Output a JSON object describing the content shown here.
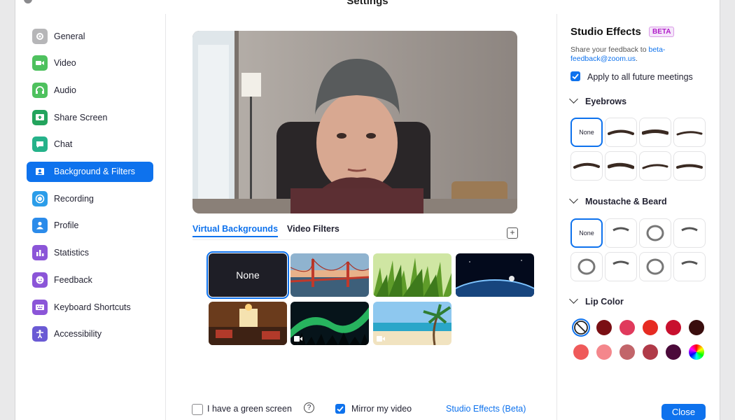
{
  "window": {
    "title": "Settings"
  },
  "sidebar": {
    "items": [
      {
        "label": "General",
        "icon": "gear-icon",
        "color": "#b6b6b8"
      },
      {
        "label": "Video",
        "icon": "video-camera-icon",
        "color": "#4ec15e"
      },
      {
        "label": "Audio",
        "icon": "headphones-icon",
        "color": "#4ec15e"
      },
      {
        "label": "Share Screen",
        "icon": "share-screen-icon",
        "color": "#23a45d"
      },
      {
        "label": "Chat",
        "icon": "chat-bubble-icon",
        "color": "#25b28a"
      },
      {
        "label": "Background & Filters",
        "icon": "person-background-icon",
        "color": "#0e72ed"
      },
      {
        "label": "Recording",
        "icon": "record-icon",
        "color": "#2b9de9"
      },
      {
        "label": "Profile",
        "icon": "user-icon",
        "color": "#2b8bea"
      },
      {
        "label": "Statistics",
        "icon": "bar-chart-icon",
        "color": "#8b55d8"
      },
      {
        "label": "Feedback",
        "icon": "smiley-icon",
        "color": "#8b55d8"
      },
      {
        "label": "Keyboard Shortcuts",
        "icon": "keyboard-icon",
        "color": "#8b55d8"
      },
      {
        "label": "Accessibility",
        "icon": "accessibility-icon",
        "color": "#6a5ad4"
      }
    ],
    "active_index": 5
  },
  "main": {
    "tabs": [
      {
        "label": "Virtual Backgrounds",
        "active": true
      },
      {
        "label": "Video Filters",
        "active": false
      }
    ],
    "add_button_label": "+",
    "backgrounds": [
      {
        "name": "None",
        "label": "None",
        "selected": true,
        "video": false
      },
      {
        "name": "Golden Gate Bridge",
        "selected": false,
        "video": false
      },
      {
        "name": "Grass",
        "selected": false,
        "video": false
      },
      {
        "name": "Earth from space",
        "selected": false,
        "video": false
      },
      {
        "name": "Lobby",
        "selected": false,
        "video": false
      },
      {
        "name": "Aurora",
        "selected": false,
        "video": true
      },
      {
        "name": "Beach",
        "selected": false,
        "video": true
      }
    ],
    "green_screen_label": "I have a green screen",
    "green_screen_checked": false,
    "mirror_label": "Mirror my video",
    "mirror_checked": true,
    "studio_effects_link": "Studio Effects (Beta)"
  },
  "studio": {
    "title": "Studio Effects",
    "badge": "BETA",
    "feedback_prefix": "Share your feedback to ",
    "feedback_email": "beta-feedback@zoom.us",
    "feedback_suffix": ".",
    "apply_label": "Apply to all future meetings",
    "apply_checked": true,
    "eyebrows_title": "Eyebrows",
    "eyebrows_none": "None",
    "beard_title": "Moustache & Beard",
    "beard_none": "None",
    "lip_title": "Lip Color",
    "lip_colors": [
      "none",
      "#7a0f14",
      "#e03a5c",
      "#e62b22",
      "#c8102e",
      "#3a0d0d",
      "#ef5a5a",
      "#f4878c",
      "#c2656a",
      "#b03a48",
      "#4b0a3a",
      "rainbow"
    ],
    "close_label": "Close"
  }
}
